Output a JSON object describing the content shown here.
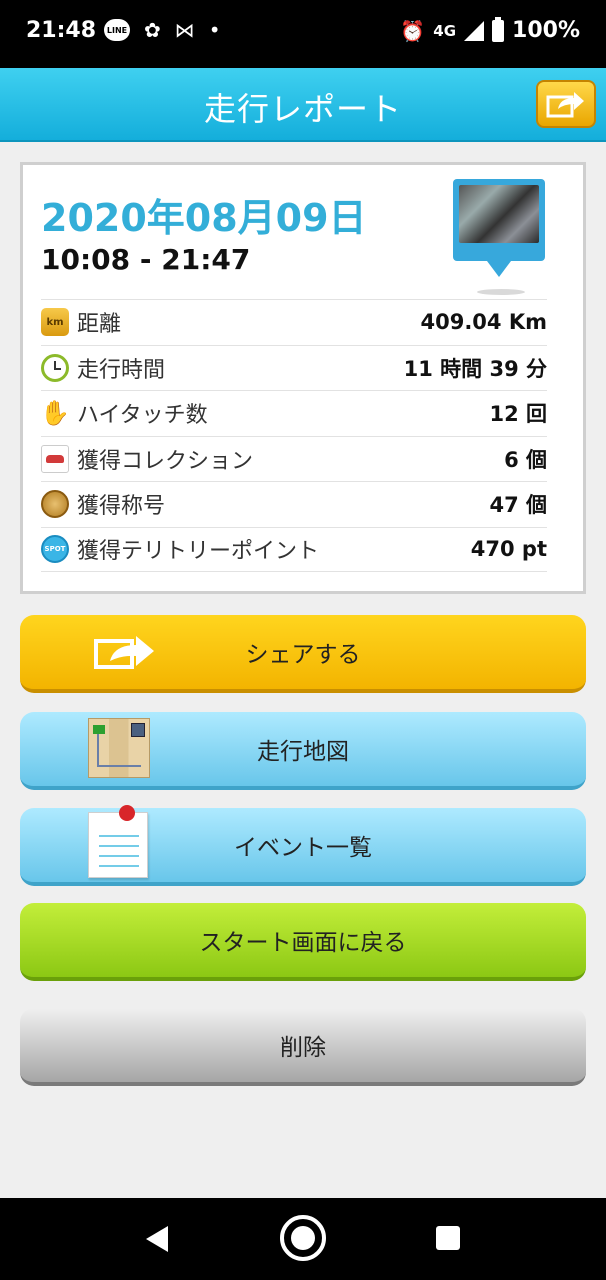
{
  "status_bar": {
    "time": "21:48",
    "network": "4G",
    "battery": "100%",
    "line_badge": "LINE",
    "icons": [
      "line-icon",
      "app-notification-icon",
      "media-icon",
      "dot-icon",
      "alarm-icon",
      "signal-icon",
      "battery-icon"
    ]
  },
  "header": {
    "title": "走行レポート",
    "share_icon": "share-icon"
  },
  "report": {
    "date": "2020年08月09日",
    "time_range": "10:08 - 21:47",
    "rows": [
      {
        "icon": "km-icon",
        "icon_text": "km",
        "label": "距離",
        "value": "409.04 Km"
      },
      {
        "icon": "clock-icon",
        "label": "走行時間",
        "value": "11 時間 39 分"
      },
      {
        "icon": "hi-five-hand-icon",
        "label": "ハイタッチ数",
        "value": "12 回"
      },
      {
        "icon": "car-icon",
        "label": "獲得コレクション",
        "value": "6 個"
      },
      {
        "icon": "medal-icon",
        "label": "獲得称号",
        "value": "47 個"
      },
      {
        "icon": "spot-icon",
        "icon_text": "SPOT",
        "label": "獲得テリトリーポイント",
        "value": "470 pt"
      }
    ]
  },
  "buttons": {
    "share": "シェアする",
    "map": "走行地図",
    "events": "イベント一覧",
    "back_to_start": "スタート画面に戻る",
    "delete": "削除"
  },
  "colors": {
    "header": "#14aedb",
    "date_text": "#33aed8",
    "share_button": "#f3b400",
    "blue_button": "#68c6ea",
    "green_button": "#8cc814",
    "gray_button": "#a6a6a6"
  }
}
